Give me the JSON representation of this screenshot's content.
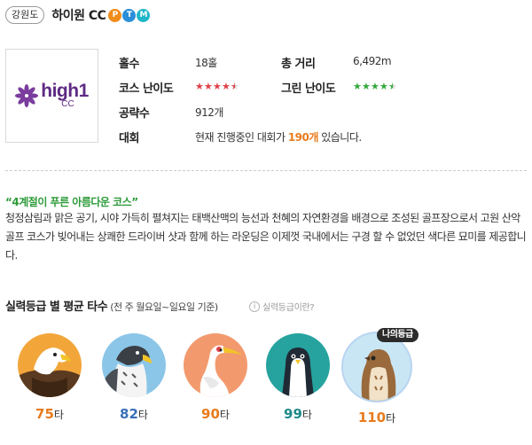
{
  "header": {
    "region": "강원도",
    "course_name": "하이원 CC",
    "badges": [
      {
        "letter": "P",
        "color": "#f08c1b"
      },
      {
        "letter": "T",
        "color": "#2a8fd8"
      },
      {
        "letter": "M",
        "color": "#1fb6c9"
      }
    ]
  },
  "logo": {
    "icon": "flower-logo-icon",
    "line1": "high1",
    "line2": "CC",
    "color": "#5e2a84"
  },
  "info": {
    "holes_label": "홀수",
    "holes_value": "18홀",
    "distance_label": "총 거리",
    "distance_value": "6,492m",
    "course_difficulty_label": "코스 난이도",
    "course_difficulty_rating": 4.5,
    "green_difficulty_label": "그린 난이도",
    "green_difficulty_rating": 4.5,
    "strategy_label": "공략수",
    "strategy_value": "912개",
    "tournament_label": "대회",
    "tournament_prefix": "현재 진행중인 대회가 ",
    "tournament_count": "190개",
    "tournament_suffix": " 있습니다."
  },
  "colors": {
    "course_star": "#e0414a",
    "green_star": "#33a93c",
    "highlight": "#e87b1c",
    "slogan": "#2e9b3a"
  },
  "description": {
    "slogan": "“4계절이 푸른 아름다운 코스”",
    "text": "청정삼림과 맑은 공기, 시야 가득히 펼쳐지는 태백산맥의 능선과 천혜의 자연환경을 배경으로 조성된 골프장으로서 고원 산악골프 코스가 빚어내는 상쾌한 드라이버 샷과 함께 하는 라운딩은 이제껏 국내에서는 구경 할 수 없었던 색다른 묘미를 제공합니다."
  },
  "levels_section": {
    "title": "실력등급 별 평균 타수",
    "subtitle": " (전 주 월요일~일요일 기준)",
    "help_text": "실력등급이란?",
    "my_level_tag": "나의등급",
    "levels": [
      {
        "score": "75",
        "unit": "타",
        "bird": "eagle-icon",
        "color": "#e87b1c"
      },
      {
        "score": "82",
        "unit": "타",
        "bird": "hawk-icon",
        "color": "#3a6fb8"
      },
      {
        "score": "90",
        "unit": "타",
        "bird": "crane-icon",
        "color": "#e87b1c"
      },
      {
        "score": "99",
        "unit": "타",
        "bird": "penguin-icon",
        "color": "#1e8a8a"
      },
      {
        "score": "110",
        "unit": "타",
        "bird": "sparrow-icon",
        "color": "#e87b1c"
      }
    ]
  }
}
